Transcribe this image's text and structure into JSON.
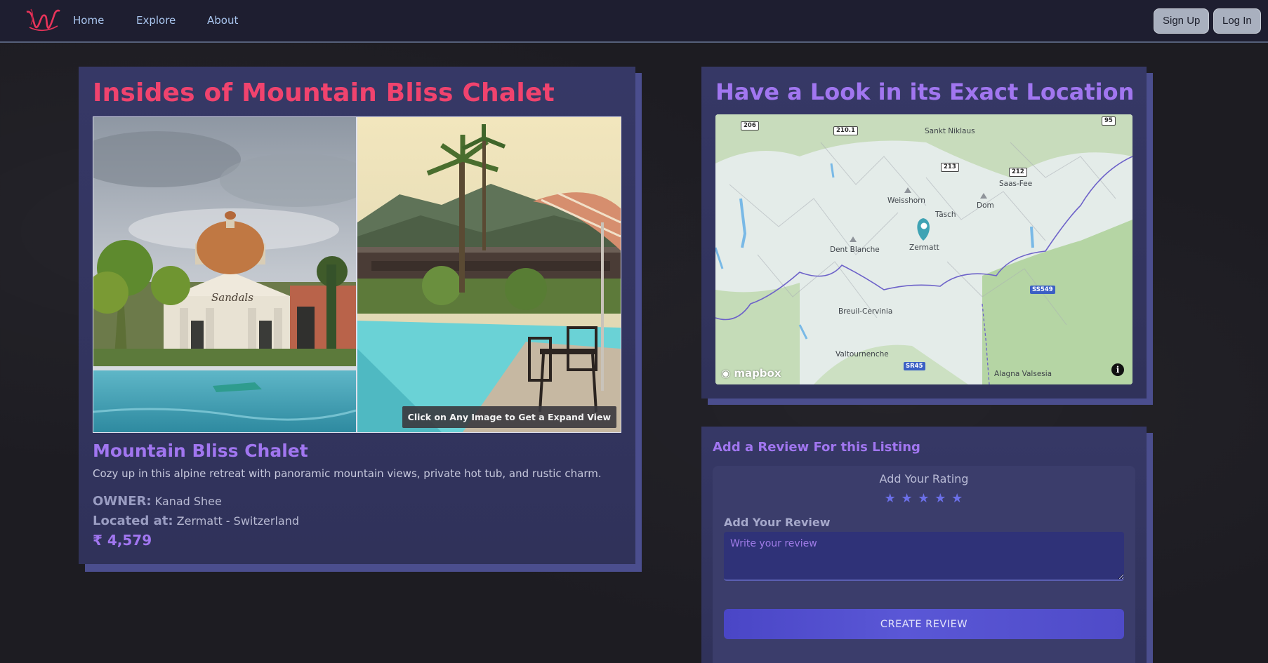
{
  "nav": {
    "links": [
      "Home",
      "Explore",
      "About"
    ],
    "signup_label": "Sign Up",
    "login_label": "Log In"
  },
  "listing": {
    "gallery_title": "Insides of Mountain Bliss Chalet",
    "expand_hint": "Click on Any Image to Get a Expand View",
    "name": "Mountain Bliss Chalet",
    "description": "Cozy up in this alpine retreat with panoramic mountain views, private hot tub, and rustic charm.",
    "owner_label": "OWNER:",
    "owner_value": "Kanad Shee",
    "location_label": "Located at:",
    "location_value": "Zermatt - Switzerland",
    "price": "₹ 4,579",
    "photo_sign_text": "Sandals"
  },
  "map": {
    "title": "Have a Look in its Exact Location",
    "places": [
      "Sankt Niklaus",
      "Saas-Fee",
      "Weisshorn",
      "Dom",
      "Täsch",
      "Dent Blanche",
      "Zermatt",
      "Breuil-Cervinia",
      "Valtournenche",
      "Alagna Valsesia"
    ],
    "roads": [
      "206",
      "210.1",
      "213",
      "212",
      "95"
    ],
    "blue_roads": [
      "SS549",
      "SR45"
    ],
    "attribution": "mapbox",
    "info_symbol": "i"
  },
  "review": {
    "heading": "Add a Review For this Listing",
    "rating_label": "Add Your Rating",
    "stars": [
      "★",
      "★",
      "★",
      "★",
      "★"
    ],
    "review_label": "Add Your Review",
    "review_placeholder": "Write your review",
    "submit_label": "CREATE REVIEW"
  },
  "colors": {
    "accent_pink": "#f0436e",
    "accent_purple": "#a176f0",
    "card": "#363863",
    "card_shadow": "#4b4e8e",
    "navbar": "#1e1e30",
    "button": "#4f4bc8"
  }
}
